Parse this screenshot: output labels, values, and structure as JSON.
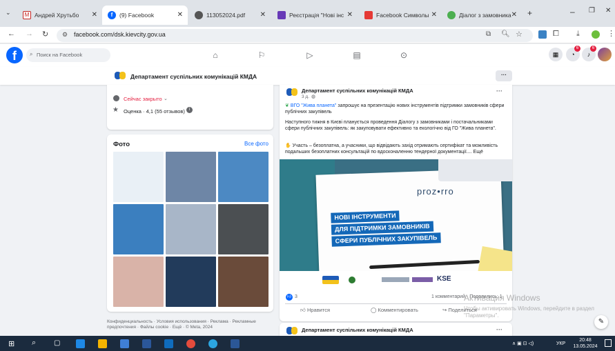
{
  "browser": {
    "tabs": [
      {
        "label": "Андрей Хрутьбо",
        "icon": "gmail-icon",
        "color": "#c5221f"
      },
      {
        "label": "(9) Facebook",
        "icon": "facebook-icon",
        "color": "#0866ff"
      },
      {
        "label": "113052024.pdf",
        "icon": "globe-icon",
        "color": "#555555"
      },
      {
        "label": "Реєстрація \"Нові інс",
        "icon": "forms-icon",
        "color": "#673ab7"
      },
      {
        "label": "Facebook Символы",
        "icon": "bookmark-icon",
        "color": "#e53935"
      },
      {
        "label": "Діалог з замовника",
        "icon": "web-icon",
        "color": "#4caf50"
      }
    ],
    "url": "facebook.com/dsk.kievcity.gov.ua"
  },
  "facebook": {
    "logo": "f",
    "search_placeholder": "Поиск на Facebook",
    "badges": {
      "messenger": "6",
      "notifications": "6"
    }
  },
  "page": {
    "name": "Департамент суспільних комунікацій КМДА",
    "more_label": "···"
  },
  "about": {
    "status": "Сейчас закрыто",
    "rating": "Оценка · 4,1 (55 отзывов)"
  },
  "photos": {
    "title": "Фото",
    "see_all": "Все фото",
    "tiles": [
      "#e9f0f6",
      "#6e86a6",
      "#4c89c3",
      "#3b7fbf",
      "#a8b6c8",
      "#4b4f52",
      "#d9b3a8",
      "#223b5b",
      "#6a4b3a"
    ]
  },
  "footer": {
    "links": "Конфиденциальность · Условия использования · Реклама · Рекламные предпочтения · Файлы cookie · Ещё · © Meta, 2024"
  },
  "post": {
    "author": "Департамент суспільних комунікацій КМДА",
    "time": "3 д.",
    "p1_link": "ВГО \"Жива планета\"",
    "p1_rest": "запрошує на презентацію нових інструментів підтримки замовників сфери публічних закупівель",
    "p2": "Наступного тижня в Києві планується проведення Діалогу з замовниками і постачальниками сфери публічних закупівель: як закуповувати ефективно та екологічно від ГО \"Жива планета\".",
    "p3": "Участь – безоплатна, а учасники, що відвідають захід отримають сертифікат та можливість подальших безоплатних консультацій по вдосконаленню тендерної документації.... Ещё",
    "image": {
      "brand": "proz•rro",
      "line1": "НОВІ ІНСТРУМЕНТИ",
      "line2": "ДЛЯ ПІДТРИМКИ ЗАМОВНИКІВ",
      "line3": "СФЕРИ ПУБЛІЧНИХ ЗАКУПІВЕЛЬ"
    },
    "reactions_count": "3",
    "stats": "1 комментарий · Поделились: 1",
    "actions": {
      "like": "Нравится",
      "comment": "Комментировать",
      "share": "Поделиться"
    }
  },
  "next_post": {
    "author": "Департамент суспільних комунікацій КМДА"
  },
  "windows": {
    "activate_title": "Активация Windows",
    "activate_text": "Чтобы активировать Windows, перейдите в раздел \"Параметры\".",
    "lang": "УКР",
    "time": "20:48",
    "date": "13.05.2024"
  }
}
